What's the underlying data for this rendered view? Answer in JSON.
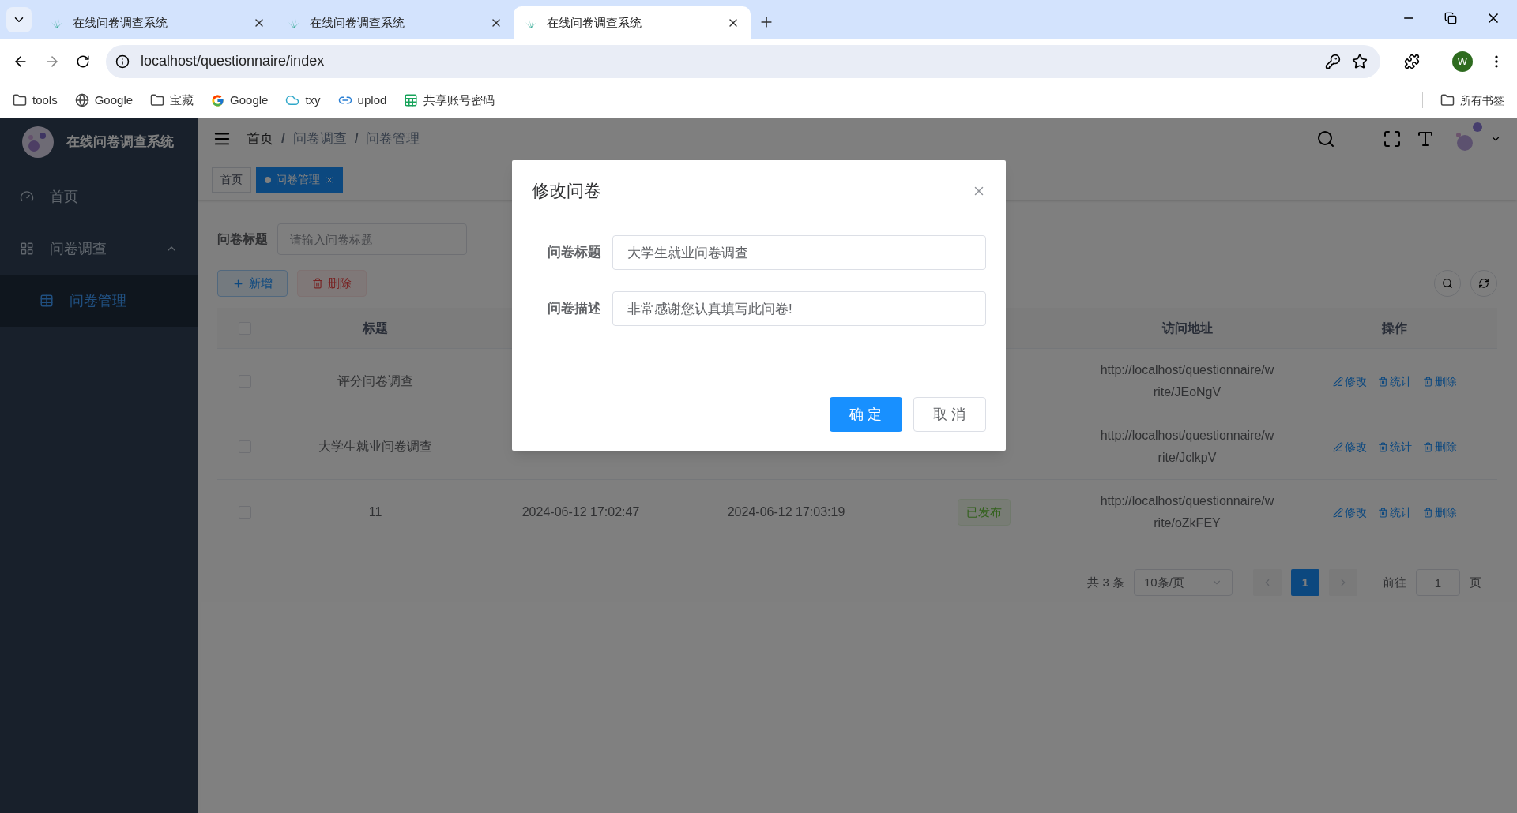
{
  "browser": {
    "tabs": [
      {
        "title": "在线问卷调查系统",
        "selected": false
      },
      {
        "title": "在线问卷调查系统",
        "selected": false
      },
      {
        "title": "在线问卷调查系统",
        "selected": true
      }
    ],
    "url": "localhost/questionnaire/index",
    "profile": "W",
    "bookmarks": [
      {
        "kind": "folder",
        "label": "tools"
      },
      {
        "kind": "globe",
        "label": "Google"
      },
      {
        "kind": "folder",
        "label": "宝藏"
      },
      {
        "kind": "google",
        "label": "Google"
      },
      {
        "kind": "cloud",
        "label": "txy"
      },
      {
        "kind": "link",
        "label": "uplod"
      },
      {
        "kind": "sheet",
        "label": "共享账号密码"
      }
    ],
    "all_bookmarks": "所有书签"
  },
  "sidebar": {
    "title": "在线问卷调查系统",
    "items": [
      {
        "kind": "dashboard",
        "label": "首页",
        "selected": false
      },
      {
        "kind": "grid",
        "label": "问卷调查",
        "selected": false,
        "expanded": true,
        "children": [
          {
            "kind": "table",
            "label": "问卷管理",
            "selected": true
          }
        ]
      }
    ]
  },
  "breadcrumb": [
    {
      "kind": "link",
      "text": "首页"
    },
    {
      "kind": "separator",
      "text": "/"
    },
    {
      "kind": "item",
      "text": "问卷调查"
    },
    {
      "kind": "separator",
      "text": "/"
    },
    {
      "kind": "item",
      "text": "问卷管理"
    }
  ],
  "tags": [
    {
      "label": "首页",
      "selected": false
    },
    {
      "label": "问卷管理",
      "selected": true
    }
  ],
  "filter": {
    "label": "问卷标题",
    "placeholder": "请输入问卷标题"
  },
  "toolbar": {
    "add": "新增",
    "delete": "删除"
  },
  "table": {
    "select_all": {
      "checked": false
    },
    "columns": {
      "title": "标题",
      "url": "访问地址",
      "actions": "操作"
    },
    "rows": [
      {
        "checked": false,
        "title": "评分问卷调查",
        "url": "http://localhost/questionnaire/write/JEoNgV",
        "actions": [
          "修改",
          "统计",
          "删除"
        ]
      },
      {
        "checked": false,
        "title": "大学生就业问卷调查",
        "url": "http://localhost/questionnaire/write/JclkpV",
        "actions": [
          "修改",
          "统计",
          "删除"
        ]
      },
      {
        "checked": false,
        "title": "11",
        "column_2": "2024-06-12 17:02:47",
        "column_3": "2024-06-12 17:03:19",
        "status": "已发布",
        "url": "http://localhost/questionnaire/write/oZkFEY",
        "actions": [
          "修改",
          "统计",
          "删除"
        ]
      }
    ]
  },
  "pagination": {
    "total": "共 3 条",
    "page_size": "10条/页",
    "pages": [
      {
        "label": "1",
        "selected": true
      }
    ],
    "goto_label": "前往",
    "goto_value": "1",
    "goto_suffix": "页"
  },
  "dialog": {
    "title": "修改问卷",
    "fields": [
      {
        "label": "问卷标题",
        "value": "大学生就业问卷调查"
      },
      {
        "label": "问卷描述",
        "value": "非常感谢您认真填写此问卷!"
      }
    ],
    "confirm": "确 定",
    "cancel": "取 消"
  }
}
